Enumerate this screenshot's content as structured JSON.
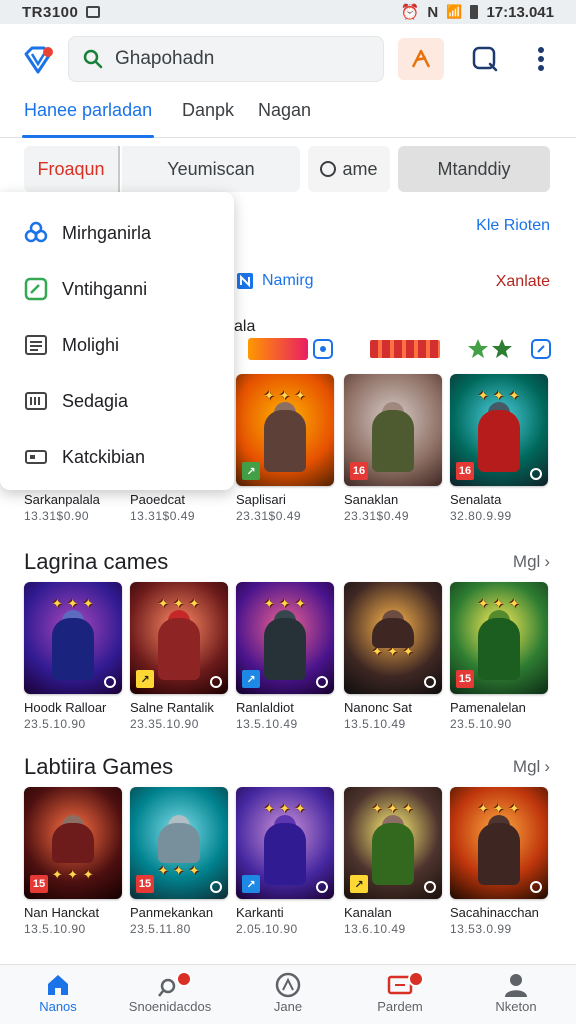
{
  "status_bar": {
    "time": "TR3100",
    "right_text": "N",
    "clock": "17:13.041"
  },
  "search": {
    "placeholder": "Ghapohadn"
  },
  "tabs": [
    {
      "label": "Hanee parladan"
    },
    {
      "label": "Danpk"
    },
    {
      "label": "Nagan"
    }
  ],
  "chips": [
    {
      "label": "Froaqun"
    },
    {
      "label": "Yeumiscan"
    },
    {
      "label": "ame"
    },
    {
      "label": "Mtanddiy"
    }
  ],
  "menu": {
    "items": [
      {
        "label": "Mirhganirla",
        "icon": "clover-icon"
      },
      {
        "label": "Vntihganni",
        "icon": "edit-square-icon"
      },
      {
        "label": "Molighi",
        "icon": "list-icon"
      },
      {
        "label": "Sedagia",
        "icon": "barcode-icon"
      },
      {
        "label": "Katckibian",
        "icon": "card-icon"
      }
    ]
  },
  "links": {
    "top_right": "Kle Rioten",
    "mid_center": "Namirg",
    "mid_right": "Xanlate",
    "partial": "ala"
  },
  "row1": [
    {
      "title": "Sarkanpalala",
      "meta": "13.31$0.90"
    },
    {
      "title": "Paoedcat",
      "meta": "13.31$0.49"
    },
    {
      "title": "Saplisari",
      "meta": "23.31$0.49"
    },
    {
      "title": "Sanaklan",
      "meta": "23.31$0.49"
    },
    {
      "title": "Senalata",
      "meta": "32.80.9.99"
    }
  ],
  "section2": {
    "title": "Lagrina cames",
    "more": "Mgl"
  },
  "row2": [
    {
      "title": "Hoodk Ralloar",
      "meta": "23.5.10.90"
    },
    {
      "title": "Salne Rantalik",
      "meta": "23.35.10.90"
    },
    {
      "title": "Ranlaldiot",
      "meta": "13.5.10.49"
    },
    {
      "title": "Nanonc Sat",
      "meta": "13.5.10.49"
    },
    {
      "title": "Pamenalelan",
      "meta": "23.5.10.90"
    }
  ],
  "section3": {
    "title": "Labtiira Games",
    "more": "Mgl"
  },
  "row3": [
    {
      "title": "Nan Hanckat",
      "meta": "13.5.10.90"
    },
    {
      "title": "Panmekankan",
      "meta": "23.5.11.80"
    },
    {
      "title": "Karkanti",
      "meta": "2.05.10.90"
    },
    {
      "title": "Kanalan",
      "meta": "13.6.10.49"
    },
    {
      "title": "Sacahinacchan",
      "meta": "13.53.0.99"
    }
  ],
  "bottom_nav": [
    {
      "label": "Nanos",
      "icon": "home-icon"
    },
    {
      "label": "Snoenidacdos",
      "icon": "search-badge-icon"
    },
    {
      "label": "Jane",
      "icon": "compass-icon"
    },
    {
      "label": "Pardem",
      "icon": "inbox-badge-icon"
    },
    {
      "label": "Nketon",
      "icon": "profile-icon"
    }
  ],
  "colors": {
    "accent": "#1a73e8",
    "chip_red": "#d93025",
    "menu_bg": "#ffffff"
  }
}
